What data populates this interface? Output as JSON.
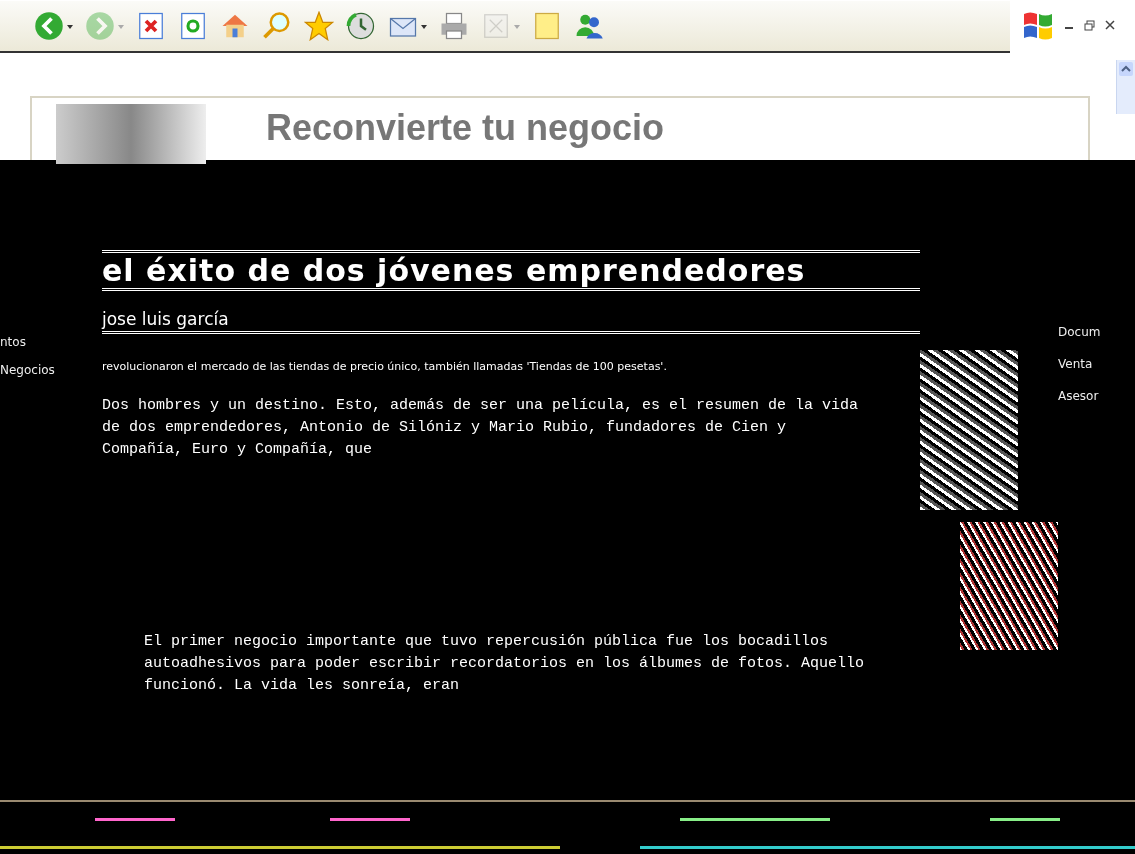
{
  "toolbar": {
    "buttons": [
      {
        "kind": "back",
        "disabled": false,
        "dropdown": true
      },
      {
        "kind": "forward",
        "disabled": true,
        "dropdown": true
      },
      {
        "kind": "stop",
        "disabled": false,
        "dropdown": false
      },
      {
        "kind": "refresh",
        "disabled": false,
        "dropdown": false
      },
      {
        "kind": "home",
        "disabled": false,
        "dropdown": false
      },
      {
        "kind": "search",
        "disabled": false,
        "dropdown": false
      },
      {
        "kind": "favorites",
        "disabled": false,
        "dropdown": false
      },
      {
        "kind": "history",
        "disabled": false,
        "dropdown": false
      },
      {
        "kind": "mail",
        "disabled": false,
        "dropdown": true
      },
      {
        "kind": "print",
        "disabled": false,
        "dropdown": false
      },
      {
        "kind": "edit",
        "disabled": true,
        "dropdown": true
      },
      {
        "kind": "note",
        "disabled": false,
        "dropdown": false
      },
      {
        "kind": "messenger",
        "disabled": false,
        "dropdown": false
      }
    ]
  },
  "header": {
    "title": "Reconvierte tu negocio"
  },
  "left_nav": [
    "ntos",
    "Negocios"
  ],
  "right_nav": [
    "Docum",
    "Venta",
    "Asesor"
  ],
  "article": {
    "title": "el éxito de dos jóvenes emprendedores",
    "author": "jose luis garcía",
    "lead": "revolucionaron el mercado de las tiendas de precio único, también llamadas 'Tiendas de 100 pesetas'.",
    "paragraphs": [
      "Dos hombres y un destino. Esto, además de ser una película, es el resumen de la vida de dos emprendedores, Antonio de Silóniz y Mario Rubio, fundadores de Cien y Compañía, Euro y Compañía, que",
      "El primer negocio importante que tuvo repercusión pública fue los bocadillos autoadhesivos para poder escribir recordatorios en los álbumes de fotos. Aquello funcionó. La vida les sonreía, eran"
    ]
  }
}
